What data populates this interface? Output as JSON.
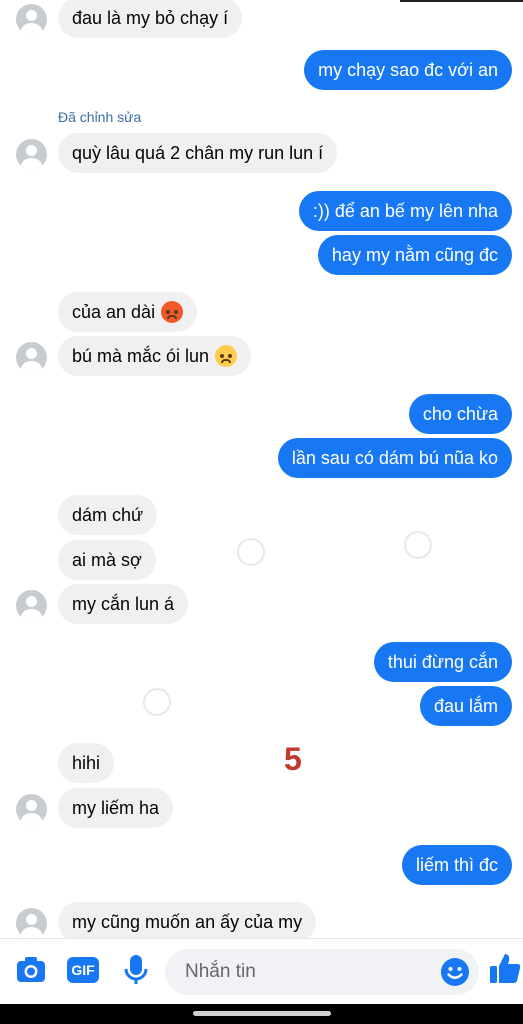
{
  "edited_label": "Đã chỉnh sửa",
  "messages": [
    {
      "text": "đau là my bỏ chạy í"
    },
    {
      "text": "my chạy sao đc với an"
    },
    {
      "text": "quỳ lâu quá 2 chân my run lun í"
    },
    {
      "text": ":)) để an bế my lên nha"
    },
    {
      "text": "hay my nằm cũng đc"
    },
    {
      "text": "của an dài"
    },
    {
      "text": "bú mà mắc ói lun"
    },
    {
      "text": "cho chừa"
    },
    {
      "text": "lần sau có dám bú nũa ko"
    },
    {
      "text": "dám chứ"
    },
    {
      "text": "ai mà sợ"
    },
    {
      "text": "my cắn lun á"
    },
    {
      "text": "thui đừng cắn"
    },
    {
      "text": "đau lắm"
    },
    {
      "text": "hihi"
    },
    {
      "text": "my liếm ha"
    },
    {
      "text": "liếm thì đc"
    },
    {
      "text": "my cũng muốn an ấy của my"
    }
  ],
  "overlay_number": "5",
  "composer": {
    "placeholder": "Nhắn tin",
    "gif_label": "GIF",
    "icons": [
      "camera-icon",
      "gif-icon",
      "microphone-icon",
      "emoji-icon",
      "thumbs-up-icon"
    ]
  },
  "colors": {
    "outgoing_bubble": "#1877f2",
    "incoming_bubble": "#f0f0f0",
    "accent": "#1877f2",
    "overlay_number": "#c0392b"
  }
}
